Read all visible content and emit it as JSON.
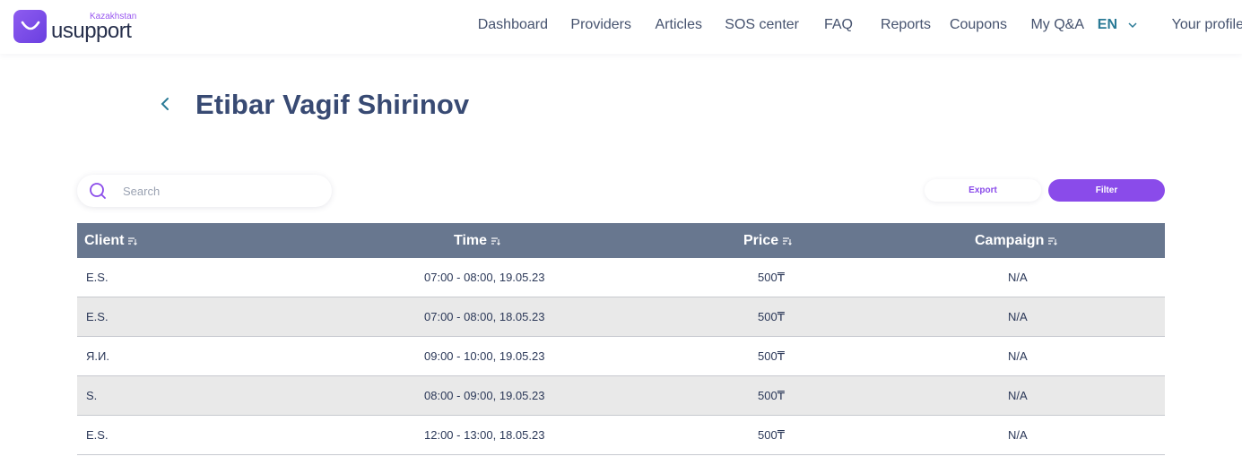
{
  "brand": {
    "name": "usupport",
    "region": "Kazakhstan",
    "logo_icon": "smile-bag-icon",
    "accent_color": "#8a4bea"
  },
  "nav": {
    "items": [
      {
        "label": "Dashboard"
      },
      {
        "label": "Providers"
      },
      {
        "label": "Articles"
      },
      {
        "label": "SOS center"
      },
      {
        "label": "FAQ"
      },
      {
        "label": "Reports"
      },
      {
        "label": "Coupons"
      },
      {
        "label": "My Q&A"
      }
    ],
    "language": "EN",
    "profile": "Your profile"
  },
  "page": {
    "title": "Etibar Vagif Shirinov",
    "back_icon": "chevron-left-icon"
  },
  "search": {
    "placeholder": "Search",
    "value": ""
  },
  "actions": {
    "export_label": "Export",
    "filter_label": "Filter"
  },
  "table": {
    "header_color": "#68778f",
    "columns": [
      {
        "label": "Client"
      },
      {
        "label": "Time"
      },
      {
        "label": "Price"
      },
      {
        "label": "Campaign"
      }
    ],
    "rows": [
      {
        "client": "E.S.",
        "time": "07:00 - 08:00, 19.05.23",
        "price": "500₸",
        "campaign": "N/A"
      },
      {
        "client": "E.S.",
        "time": "07:00 - 08:00, 18.05.23",
        "price": "500₸",
        "campaign": "N/A"
      },
      {
        "client": "Я.И.",
        "time": "09:00 - 10:00, 19.05.23",
        "price": "500₸",
        "campaign": "N/A"
      },
      {
        "client": "S.",
        "time": "08:00 - 09:00, 19.05.23",
        "price": "500₸",
        "campaign": "N/A"
      },
      {
        "client": "E.S.",
        "time": "12:00 - 13:00, 18.05.23",
        "price": "500₸",
        "campaign": "N/A"
      }
    ]
  }
}
